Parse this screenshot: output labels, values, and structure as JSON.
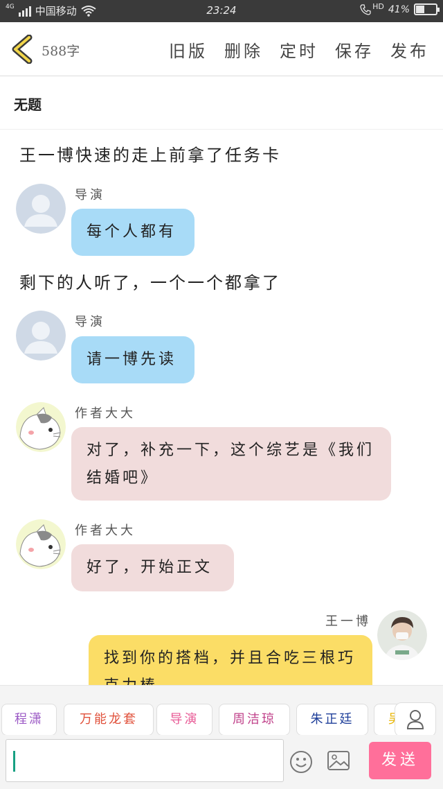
{
  "status_bar": {
    "network": "4G",
    "carrier": "中国移动",
    "time": "23:24",
    "hd": "HD",
    "battery": "41%",
    "battery_level": 0.41
  },
  "header": {
    "word_count": "588字",
    "actions": [
      "旧版",
      "删除",
      "定时",
      "保存",
      "发布"
    ]
  },
  "title": "无题",
  "messages": {
    "n1": "王一博快速的走上前拿了任务卡",
    "m1": {
      "speaker": "导演",
      "text": "每个人都有"
    },
    "n2": "剩下的人听了，一个一个都拿了",
    "m2": {
      "speaker": "导演",
      "text": "请一博先读"
    },
    "m3": {
      "speaker": "作者大大",
      "text": "对了，补充一下，这个综艺是《我们结婚吧》"
    },
    "m4": {
      "speaker": "作者大大",
      "text": "好了，开始正文"
    },
    "m5": {
      "speaker": "王一博",
      "text": "找到你的搭档，并且合吃三根巧克力棒"
    }
  },
  "tags": [
    {
      "label": "程潇",
      "color": "#9b59c5"
    },
    {
      "label": "万能龙套",
      "color": "#e0503a"
    },
    {
      "label": "导演",
      "color": "#e85a96"
    },
    {
      "label": "周洁琼",
      "color": "#c0408a"
    },
    {
      "label": "朱正廷",
      "color": "#1f3f9a"
    },
    {
      "label": "吴",
      "color": "#e8b400"
    }
  ],
  "input": {
    "placeholder": "",
    "send_label": "发送"
  },
  "colors": {
    "accent": "#ff6f9a",
    "director_bubble": "#a8dbf7",
    "author_bubble": "#f1dcdc",
    "self_bubble": "#fbdd66"
  },
  "icons": [
    "back-chevron-icon",
    "wifi-icon",
    "signal-icon",
    "battery-icon",
    "person-icon",
    "emoji-icon",
    "image-icon"
  ]
}
